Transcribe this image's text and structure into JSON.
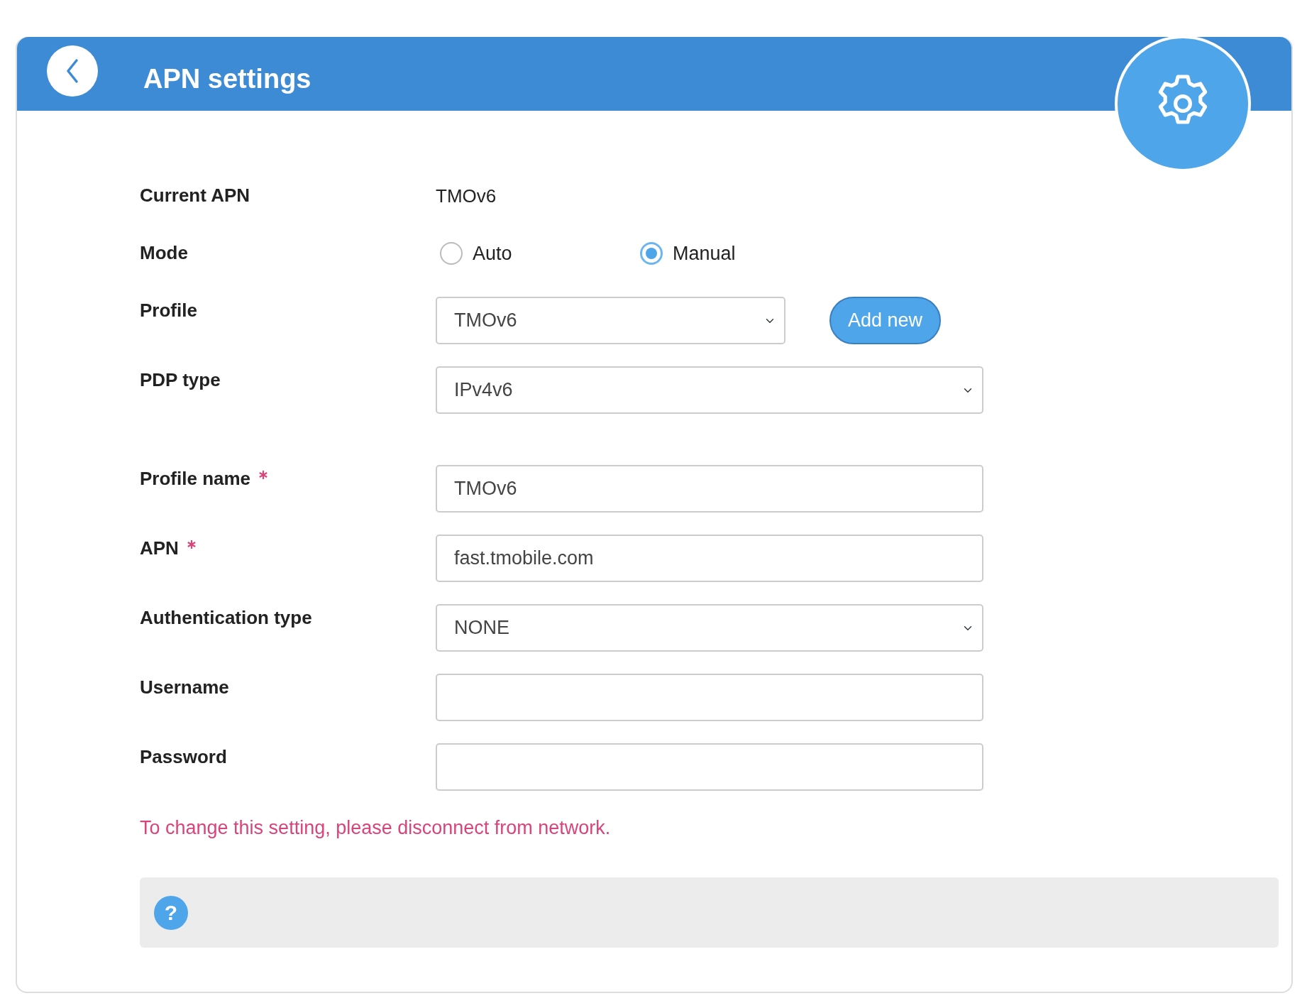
{
  "header": {
    "title": "APN settings"
  },
  "current_apn": {
    "label": "Current APN",
    "value": "TMOv6"
  },
  "mode": {
    "label": "Mode",
    "options": [
      {
        "label": "Auto",
        "selected": false
      },
      {
        "label": "Manual",
        "selected": true
      }
    ]
  },
  "selection": [
    {
      "kind": "select",
      "label": "Profile",
      "value": "TMOv6",
      "required": false,
      "action": "Add new"
    },
    {
      "kind": "select",
      "label": "PDP type",
      "value": "IPv4v6",
      "required": false
    }
  ],
  "profile_details": [
    {
      "kind": "text",
      "label": "Profile name",
      "value": "TMOv6",
      "required": true
    },
    {
      "kind": "text",
      "label": "APN",
      "value": "fast.tmobile.com",
      "required": true
    },
    {
      "kind": "select",
      "label": "Authentication type",
      "value": "NONE",
      "required": false
    },
    {
      "kind": "text",
      "label": "Username",
      "required": false
    },
    {
      "kind": "password",
      "label": "Password",
      "required": false
    }
  ],
  "warning": "To change this setting, please disconnect from network.",
  "help": {
    "icon": "?"
  }
}
